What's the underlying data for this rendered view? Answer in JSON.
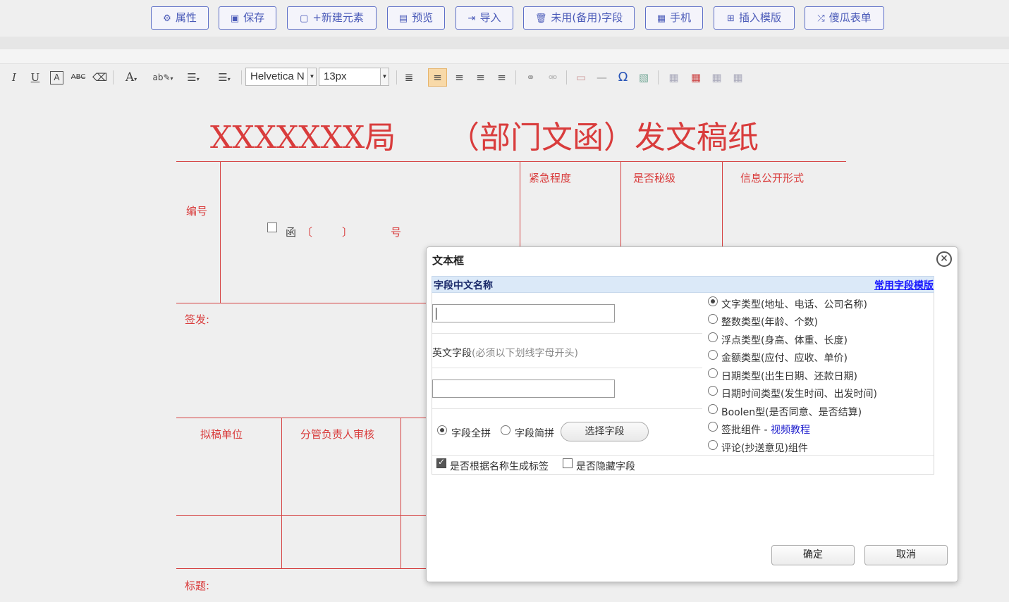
{
  "toolbar": {
    "buttons": [
      {
        "label": "属性",
        "icon": "gear-icon"
      },
      {
        "label": "保存",
        "icon": "save-icon"
      },
      {
        "label": "+新建元素",
        "icon": "new-document-icon"
      },
      {
        "label": "预览",
        "icon": "preview-icon"
      },
      {
        "label": "导入",
        "icon": "import-icon"
      },
      {
        "label": "未用(备用)字段",
        "icon": "trash-icon"
      },
      {
        "label": "手机",
        "icon": "mobile-icon"
      },
      {
        "label": "插入模版",
        "icon": "grid-icon"
      },
      {
        "label": "傻瓜表单",
        "icon": "shuffle-icon"
      }
    ]
  },
  "editor_toolbar": {
    "font_family": "Helvetica N",
    "font_size": "13px"
  },
  "document": {
    "title_left": "XXXXXXX局",
    "title_right": "（部门文函）发文稿纸",
    "label_number": "编号",
    "label_urgency": "紧急程度",
    "label_secret": "是否秘级",
    "label_disclosure": "信息公开形式",
    "letter_text": "函",
    "bracket_open": "〔",
    "bracket_close": "〕",
    "number_suffix": "号",
    "label_sign": "签发:",
    "label_draft_unit": "拟稿单位",
    "label_reviewer": "分管负责人审核",
    "label_subject": "标题:"
  },
  "dialog": {
    "title": "文本框",
    "header_label": "字段中文名称",
    "header_link": "常用字段模版",
    "chinese_name_value": "",
    "english_label": "英文字段",
    "english_hint": "(必须以下划线字母开头)",
    "english_value": "",
    "pinyin_full": "字段全拼",
    "pinyin_short": "字段简拼",
    "choose_field": "选择字段",
    "pinyin_mode": "full",
    "types": [
      {
        "label": "文字类型(地址、电话、公司名称)",
        "selected": true
      },
      {
        "label": "整数类型(年龄、个数)",
        "selected": false
      },
      {
        "label": "浮点类型(身高、体重、长度)",
        "selected": false
      },
      {
        "label": "金额类型(应付、应收、单价)",
        "selected": false
      },
      {
        "label": "日期类型(出生日期、还款日期)",
        "selected": false
      },
      {
        "label": "日期时间类型(发生时间、出发时间)",
        "selected": false
      },
      {
        "label": "Boolen型(是否同意、是否结算)",
        "selected": false
      },
      {
        "label": "签批组件 - ",
        "link": "视频教程",
        "selected": false
      },
      {
        "label": "评论(抄送意见)组件",
        "selected": false
      }
    ],
    "gen_label_text": "是否根据名称生成标签",
    "gen_label_checked": true,
    "hidden_text": "是否隐藏字段",
    "hidden_checked": false,
    "ok": "确定",
    "cancel": "取消"
  }
}
